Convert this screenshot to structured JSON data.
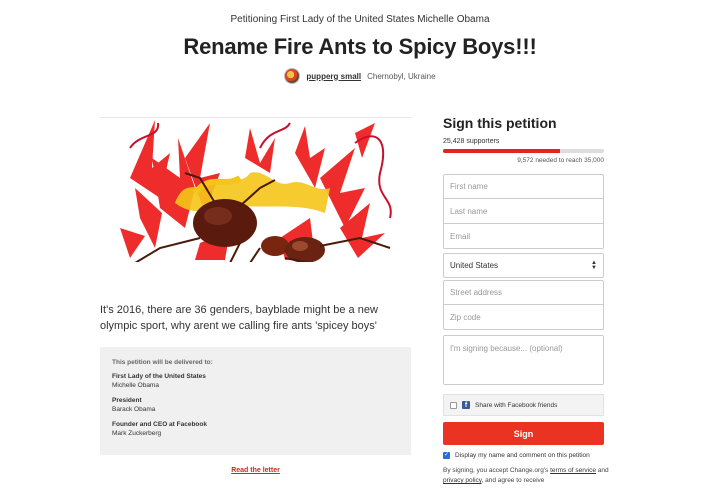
{
  "header": {
    "subtitle": "Petitioning First Lady of the United States Michelle Obama",
    "title": "Rename Fire Ants to Spicy Boys!!!",
    "author": "pupperg small",
    "location": "Chernobyl, Ukraine"
  },
  "petition": {
    "description": "It's 2016, there are 36 genders, bayblade might be a new olympic sport, why arent we calling fire ants 'spicey boys'",
    "delivery": {
      "heading": "This petition will be delivered to:",
      "recipients": [
        {
          "title": "First Lady of the United States",
          "name": "Michelle Obama"
        },
        {
          "title": "President",
          "name": "Barack Obama"
        },
        {
          "title": "Founder and CEO at Facebook",
          "name": "Mark Zuckerberg"
        }
      ]
    },
    "read_letter": "Read the letter"
  },
  "sign": {
    "title": "Sign this petition",
    "supporters": "25,428 supporters",
    "needed": "9,572 needed to reach 35,000",
    "progress_fraction": 0.7265,
    "placeholders": {
      "first_name": "First name",
      "last_name": "Last name",
      "email": "Email",
      "street": "Street address",
      "zip": "Zip code",
      "comment": "I'm signing because... (optional)"
    },
    "country": "United States",
    "fb_share": "Share with Facebook friends",
    "button": "Sign",
    "display_option": "Display my name and comment on this petition",
    "terms_prefix": "By signing, you accept Change.org's ",
    "terms_link": "terms of service",
    "terms_and": " and ",
    "privacy_link": "privacy policy",
    "terms_suffix": ", and agree to receive"
  },
  "colors": {
    "accent": "#ea3323",
    "progress_track": "#dddddd",
    "facebook": "#3b5998",
    "letter_bg": "#f1f0f0"
  },
  "icons": {
    "avatar": "avatar-image",
    "facebook": "facebook-icon",
    "select": "chevron-updown-icon",
    "checkbox": "checkbox-checked-icon"
  }
}
